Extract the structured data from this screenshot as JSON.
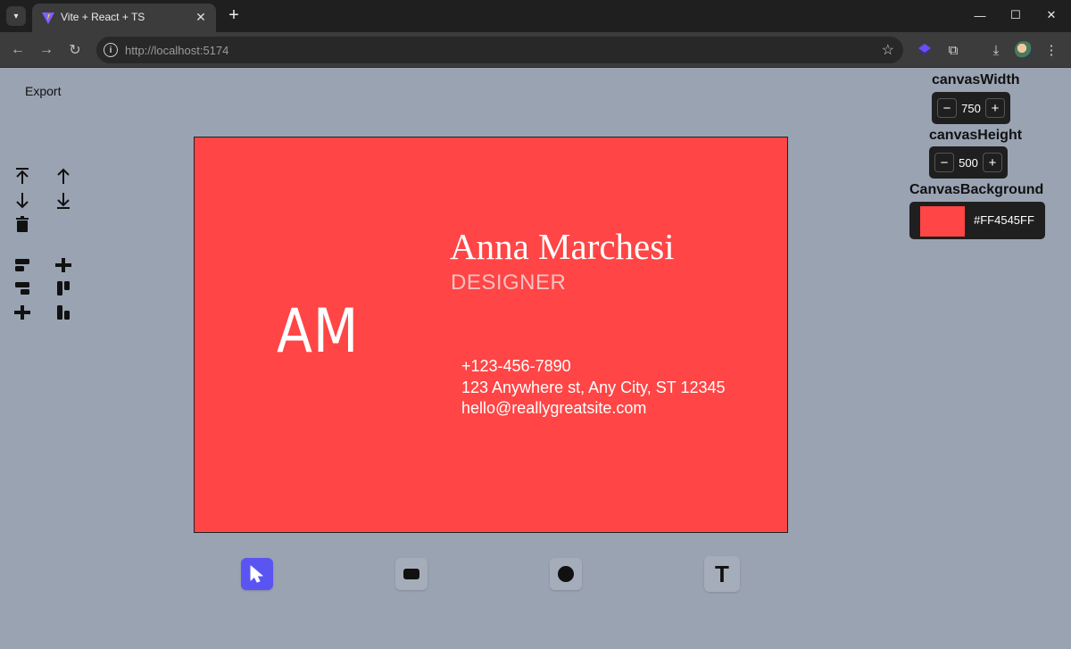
{
  "browser": {
    "tab_title": "Vite + React + TS",
    "url_host": "http://localhost",
    "url_port": ":5174"
  },
  "app": {
    "export_label": "Export"
  },
  "card": {
    "monogram": "AM",
    "name": "Anna Marchesi",
    "role": "DESIGNER",
    "phone": "+123-456-7890",
    "address": "123 Anywhere st, Any City, ST 12345",
    "email": "hello@reallygreatsite.com"
  },
  "properties": {
    "width_label": "canvasWidth",
    "width_value": "750",
    "height_label": "canvasHeight",
    "height_value": "500",
    "background_label": "CanvasBackground",
    "background_hex": "#FF4545FF"
  },
  "colors": {
    "canvas_bg": "#FF4545",
    "workspace_bg": "#9AA3B2",
    "tool_active": "#5A55F2"
  },
  "tools": [
    {
      "name": "select-tool",
      "icon": "cursor-icon"
    },
    {
      "name": "rectangle-tool",
      "icon": "rectangle-icon"
    },
    {
      "name": "circle-tool",
      "icon": "circle-icon"
    },
    {
      "name": "text-tool",
      "icon": "text-icon",
      "glyph": "T"
    }
  ]
}
